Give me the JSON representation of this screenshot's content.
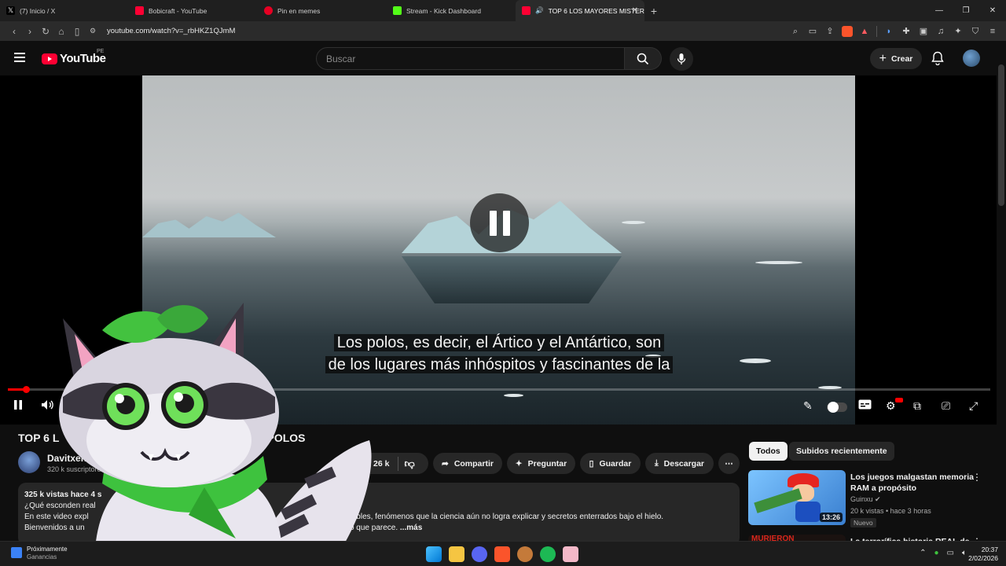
{
  "browser": {
    "tabs": [
      {
        "label": "(7) Inicio / X",
        "color": "#000000",
        "icon": "x-icon"
      },
      {
        "label": "Bobicraft - YouTube",
        "color": "#ff0033",
        "icon": "youtube-icon"
      },
      {
        "label": "Pin en memes",
        "color": "#e60023",
        "icon": "pinterest-icon"
      },
      {
        "label": "Stream - Kick Dashboard",
        "color": "#53fc18",
        "icon": "kick-icon"
      },
      {
        "label": "TOP 6 LOS MAYORES MISTER",
        "color": "#ff0033",
        "icon": "youtube-icon"
      }
    ],
    "url": "youtube.com/watch?v=_rbHKZ1QJmM"
  },
  "youtube": {
    "logo_text": "YouTube",
    "region": "PE",
    "search_placeholder": "Buscar",
    "create_label": "Crear"
  },
  "player": {
    "caption_line1": "Los polos, es decir, el Ártico y el Antártico, son",
    "caption_line2": "de los lugares más inhóspitos y fascinantes de la",
    "progress": 0.018,
    "accent": "#ff0000"
  },
  "video": {
    "title_visible_start": "TOP 6 L",
    "title_visible_end": "OS POLOS",
    "channel_name": "Davitxenko",
    "subscribers": "320 k suscriptores",
    "likes": "26 k",
    "share_label": "Compartir",
    "ask_label": "Preguntar",
    "save_label": "Guardar",
    "download_label": "Descargar",
    "desc_meta": "325 k vistas  hace 4 s",
    "desc_line1": "¿Qué esconden real",
    "desc_line2_start": "En este video expl",
    "desc_line2_end": "plicables,  fenómenos que la ciencia aún no logra explicar y secretos enterrados bajo el hielo.",
    "desc_line3_start": "Bienvenidos a un",
    "desc_line3_end": "lo que parece.",
    "more_label": "...más"
  },
  "sidebar": {
    "chips": [
      "Todos",
      "Subidos recientemente"
    ],
    "recs": [
      {
        "title": "Los juegos malgastan memoria RAM a propósito",
        "channel": "Guinxu",
        "meta": "20 k vistas • hace 3 horas",
        "badge": "Nuevo",
        "duration": "13:26"
      },
      {
        "title": "La terrorífica historia REAL de",
        "thumb_text": "MURIERON"
      }
    ]
  },
  "taskbar": {
    "news_title": "Próximamente",
    "news_sub": "Ganancias",
    "time": "20:37",
    "date": "2/02/2026"
  }
}
